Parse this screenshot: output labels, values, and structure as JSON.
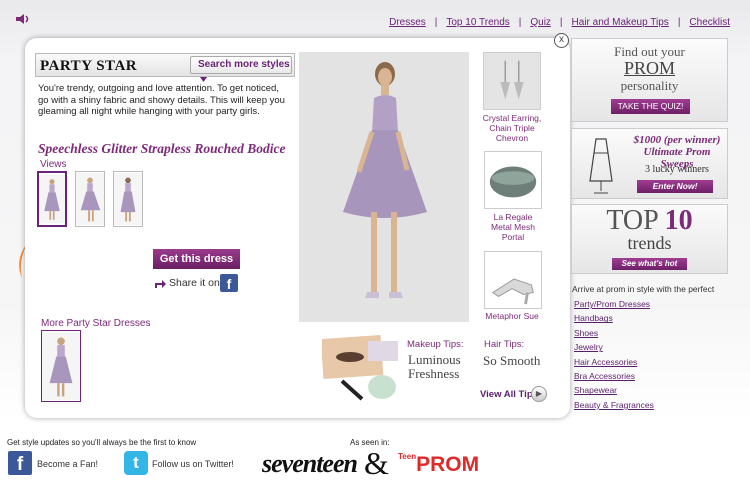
{
  "topnav": {
    "items": [
      "Dresses",
      "Top 10 Trends",
      "Quiz",
      "Hair and Makeup Tips",
      "Checklist"
    ],
    "separator": "|"
  },
  "modal": {
    "close_label": "x",
    "style_title": "PARTY STAR",
    "search_more": "Search more styles",
    "description": "You're trendy, outgoing and love attention. To get noticed, go with a shiny fabric and showy details. This will keep you gleaming all night while hanging with your party girls.",
    "dress_name": "Speechless Glitter Strapless Rouched Bodice",
    "views_label": "Views",
    "get_dress": "Get this dress",
    "share_label": "Share it on",
    "more_label": "More Party Star Dresses",
    "accessories": [
      {
        "name": "Crystal Earring, Chain Triple Chevron",
        "icon": "earring-icon"
      },
      {
        "name": "La Regale Metal Mesh Portal",
        "icon": "clutch-icon"
      },
      {
        "name": "Metaphor Sue",
        "icon": "shoe-icon"
      }
    ],
    "makeup_label": "Makeup Tips:",
    "makeup_title": "Luminous Freshness",
    "hair_label": "Hair Tips:",
    "hair_title": "So Smooth",
    "view_all": "View All Tips"
  },
  "sidebar": {
    "quiz": {
      "line1": "Find out your",
      "line2": "PROM",
      "line3": "personality",
      "button": "TAKE THE QUIZ!"
    },
    "sweeps": {
      "amount": "$1000 (per winner)",
      "title": "Ultimate Prom Sweeps",
      "winners": "3 lucky winners",
      "button": "Enter Now!"
    },
    "top10": {
      "top": "TOP",
      "num": "10",
      "trends": "trends",
      "button": "See what's hot"
    },
    "arrive_text": "Arrive at prom in style with the perfect",
    "categories": [
      "Party/Prom Dresses",
      "Handbags",
      "Shoes",
      "Jewelry",
      "Hair Accessories",
      "Bra Accessories",
      "Shapewear",
      "Beauty & Fragrances"
    ]
  },
  "footer": {
    "updates": "Get style updates so you'll always be the first to know",
    "seen_in": "As seen in:",
    "fan": "Become a Fan!",
    "twitter": "Follow us on Twitter!",
    "seventeen": "seventeen",
    "amp": "&",
    "teen": "Teen",
    "prom": "PROM"
  },
  "colors": {
    "accent": "#7d2a78",
    "link": "#5a1f6b",
    "facebook": "#3b5998",
    "twitter": "#33b5e5",
    "prom_red": "#e02a2a"
  }
}
